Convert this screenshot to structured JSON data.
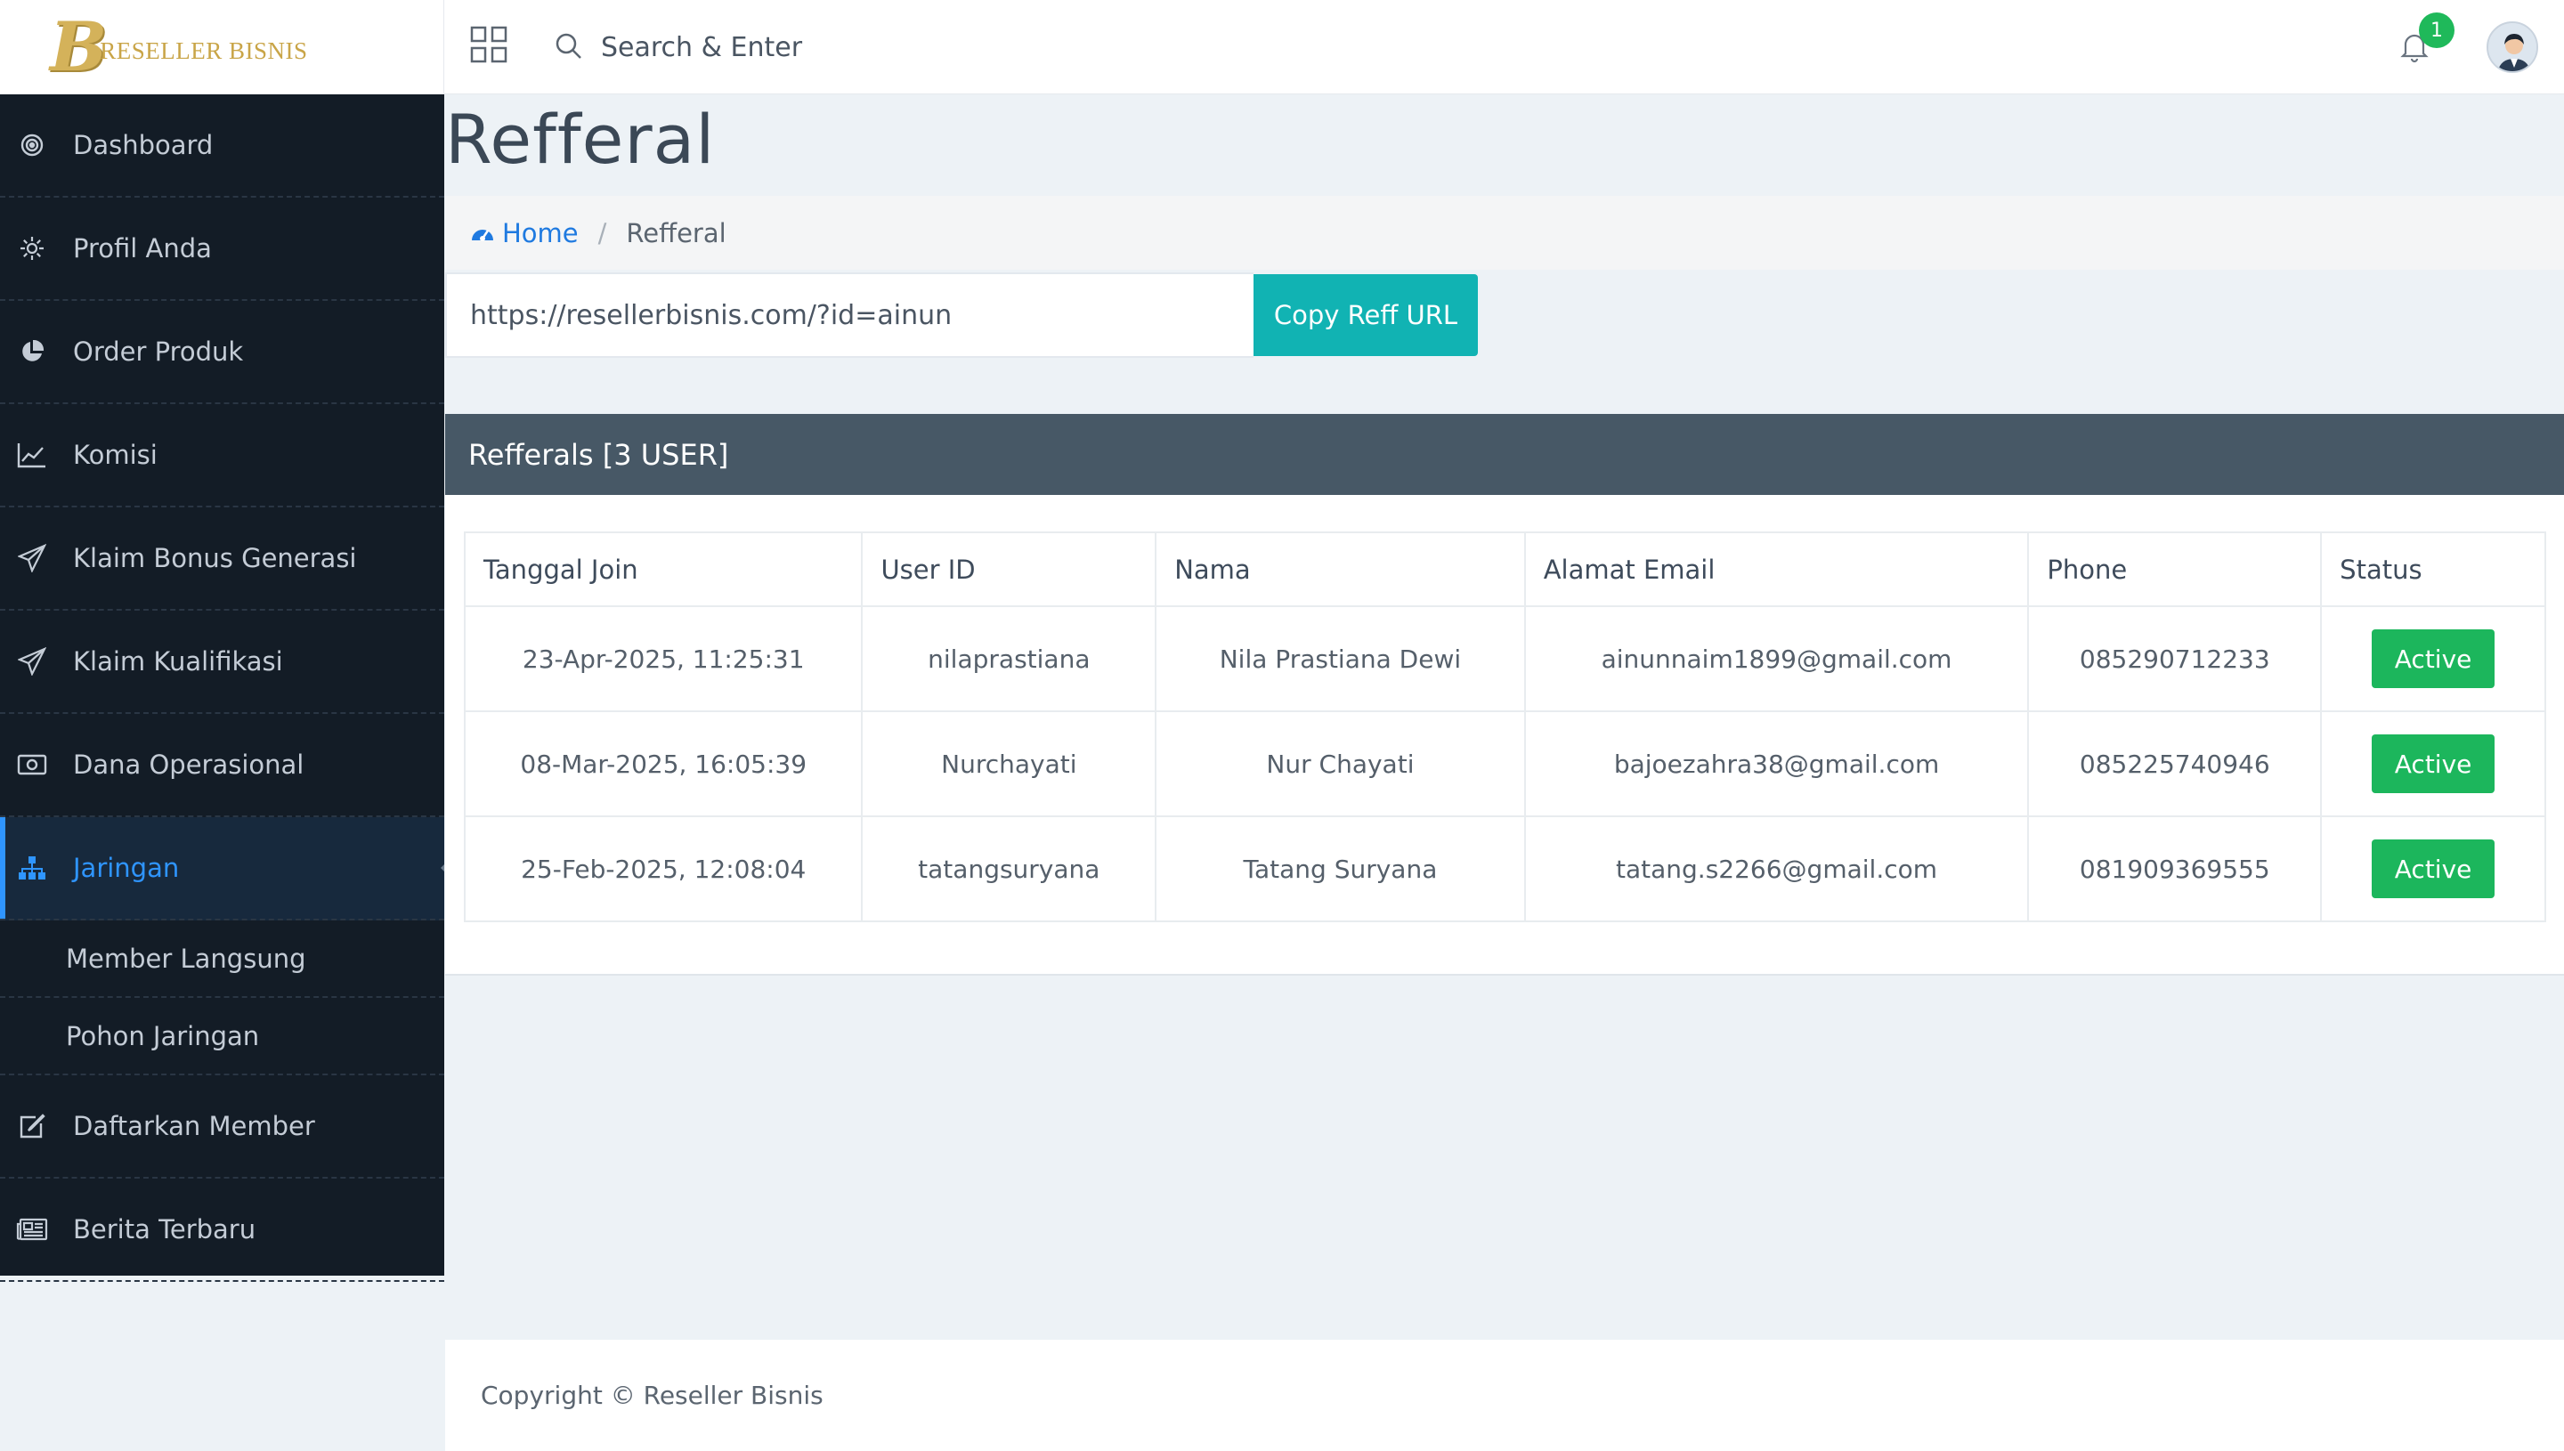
{
  "brand": {
    "logo_letter": "B",
    "name": "RESELLER BISNIS"
  },
  "topbar": {
    "search_placeholder": "Search & Enter",
    "notification_count": "1"
  },
  "sidebar": {
    "items": [
      {
        "label": "Dashboard",
        "icon": "target-icon"
      },
      {
        "label": "Profil Anda",
        "icon": "gear-icon"
      },
      {
        "label": "Order Produk",
        "icon": "pie-chart-icon"
      },
      {
        "label": "Komisi",
        "icon": "line-chart-icon"
      },
      {
        "label": "Klaim Bonus Generasi",
        "icon": "paper-plane-icon"
      },
      {
        "label": "Klaim Kualifikasi",
        "icon": "paper-plane-icon"
      },
      {
        "label": "Dana Operasional",
        "icon": "money-icon"
      },
      {
        "label": "Jaringan",
        "icon": "sitemap-icon",
        "active": true
      },
      {
        "label": "Daftarkan Member",
        "icon": "edit-icon"
      },
      {
        "label": "Berita Terbaru",
        "icon": "newspaper-icon"
      }
    ],
    "sub_items": [
      {
        "label": "Member Langsung"
      },
      {
        "label": "Pohon Jaringan"
      }
    ]
  },
  "page": {
    "title": "Refferal",
    "breadcrumb": {
      "home": "Home",
      "current": "Refferal"
    }
  },
  "referral": {
    "url": "https://resellerbisnis.com/?id=ainun",
    "copy_button": "Copy Reff URL"
  },
  "panel": {
    "title": "Refferals [3 USER]",
    "columns": [
      "Tanggal Join",
      "User ID",
      "Nama",
      "Alamat Email",
      "Phone",
      "Status"
    ],
    "rows": [
      {
        "date": "23-Apr-2025, 11:25:31",
        "user_id": "nilaprastiana",
        "name": "Nila Prastiana Dewi",
        "email": "ainunnaim1899@gmail.com",
        "phone": "085290712233",
        "status": "Active"
      },
      {
        "date": "08-Mar-2025, 16:05:39",
        "user_id": "Nurchayati",
        "name": "Nur Chayati",
        "email": "bajoezahra38@gmail.com",
        "phone": "085225740946",
        "status": "Active"
      },
      {
        "date": "25-Feb-2025, 12:08:04",
        "user_id": "tatangsuryana",
        "name": "Tatang Suryana",
        "email": "tatang.s2266@gmail.com",
        "phone": "081909369555",
        "status": "Active"
      }
    ]
  },
  "footer": {
    "copyright": "Copyright © Reseller Bisnis"
  },
  "colors": {
    "sidebar_bg": "#131c26",
    "active_blue": "#2f95ff",
    "copy_button": "#11b3b3",
    "panel_header": "#475866",
    "status_green": "#1cb65c"
  }
}
